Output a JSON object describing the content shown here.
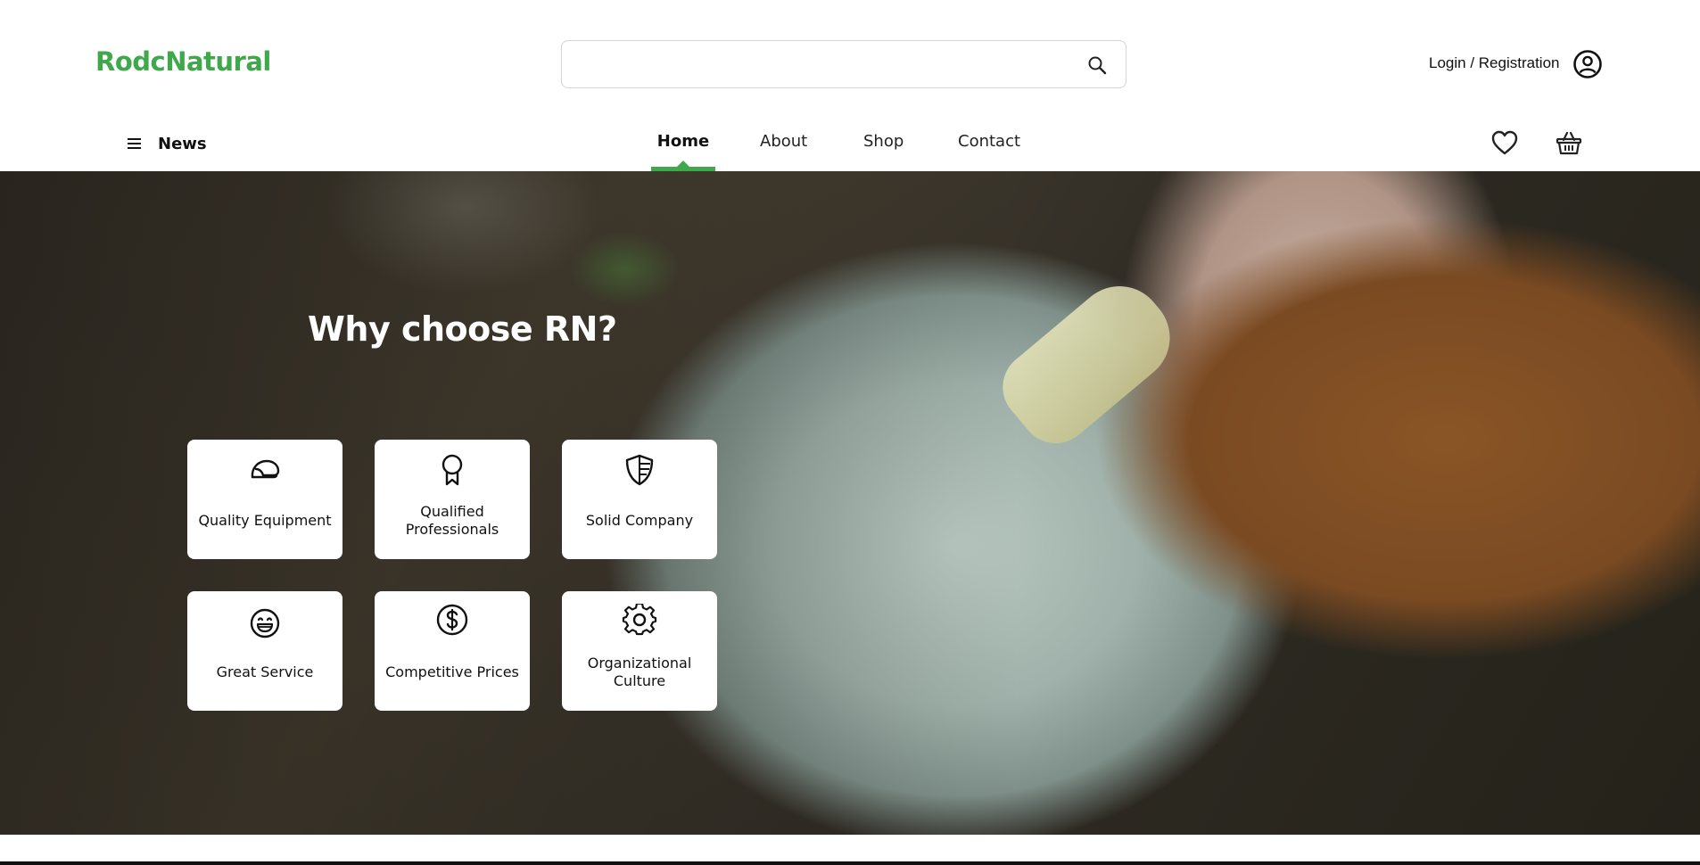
{
  "header": {
    "logo": "RodcNatural",
    "search": {
      "placeholder": "",
      "value": ""
    },
    "login_label": "Login / Registration"
  },
  "nav": {
    "news_label": "News",
    "items": [
      {
        "label": "Home",
        "active": true
      },
      {
        "label": "About",
        "active": false
      },
      {
        "label": "Shop",
        "active": false
      },
      {
        "label": "Contact",
        "active": false
      }
    ]
  },
  "hero": {
    "title": "Why choose RN?",
    "cards": [
      {
        "label": "Quality Equipment",
        "icon": "helmet-icon"
      },
      {
        "label": "Qualified Professionals",
        "icon": "award-ribbon-icon"
      },
      {
        "label": "Solid Company",
        "icon": "shield-icon"
      },
      {
        "label": "Great Service",
        "icon": "smiley-icon"
      },
      {
        "label": "Competitive Prices",
        "icon": "dollar-coin-icon"
      },
      {
        "label": "Organizational Culture",
        "icon": "gear-icon"
      }
    ]
  },
  "colors": {
    "brand_green": "#3ea84a",
    "text": "#111111",
    "card_bg": "#ffffff"
  }
}
